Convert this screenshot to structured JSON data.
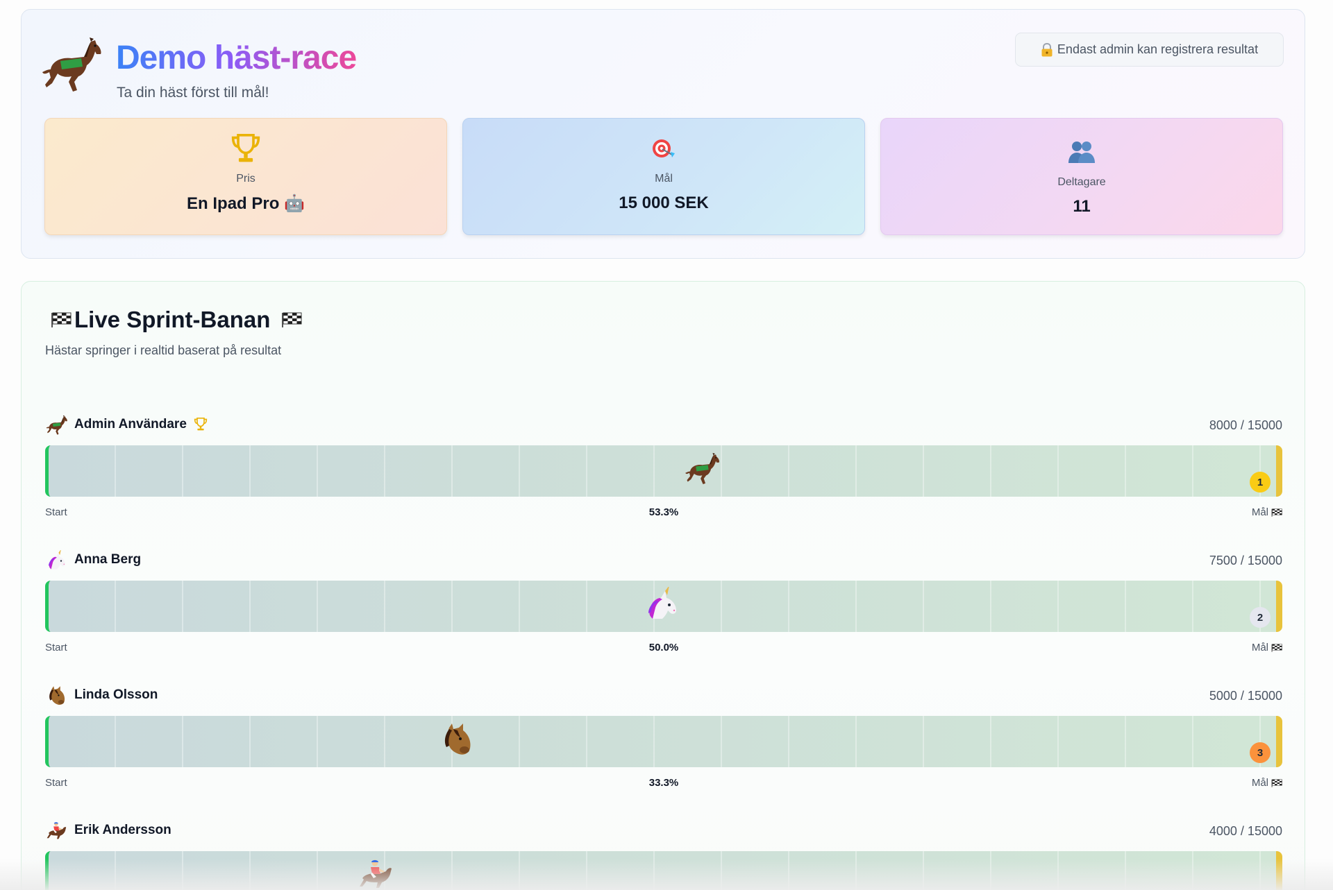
{
  "header": {
    "title": "Demo häst-race",
    "subtitle": "Ta din häst först till mål!",
    "admin_note": "Endast admin kan registrera resultat",
    "logo_icon": "racing-horse-icon"
  },
  "stats": [
    {
      "icon": "trophy-icon",
      "label": "Pris",
      "value": "En Ipad Pro 🤖"
    },
    {
      "icon": "target-icon",
      "label": "Mål",
      "value": "15 000 SEK"
    },
    {
      "icon": "people-icon",
      "label": "Deltagare",
      "value": "11"
    }
  ],
  "race": {
    "title": "Live Sprint-Banan",
    "subtitle": "Hästar springer i realtid baserat på resultat",
    "start_label": "Start",
    "goal_label": "Mål",
    "goal": 15000,
    "lanes": [
      {
        "name": "Admin Användare",
        "icon": "racing-horse-icon",
        "has_trophy": true,
        "score": "8000 / 15000",
        "progress": 53.3,
        "percent_text": "53.3%",
        "rank": "1"
      },
      {
        "name": "Anna Berg",
        "icon": "unicorn-icon",
        "has_trophy": false,
        "score": "7500 / 15000",
        "progress": 50.0,
        "percent_text": "50.0%",
        "rank": "2"
      },
      {
        "name": "Linda Olsson",
        "icon": "horse-face-icon",
        "has_trophy": false,
        "score": "5000 / 15000",
        "progress": 33.3,
        "percent_text": "33.3%",
        "rank": "3"
      },
      {
        "name": "Erik Andersson",
        "icon": "jockey-icon",
        "has_trophy": false,
        "score": "4000 / 15000",
        "progress": 26.7
      }
    ]
  },
  "colors": {
    "title_gradient": [
      "#3b82f6",
      "#8b5cf6",
      "#ec4899"
    ],
    "track_start": "#22c55e",
    "track_goal": "#e8c33c",
    "rank_gold": "#facc15",
    "rank_silver": "#e5e7ef",
    "rank_bronze": "#fb923c"
  }
}
